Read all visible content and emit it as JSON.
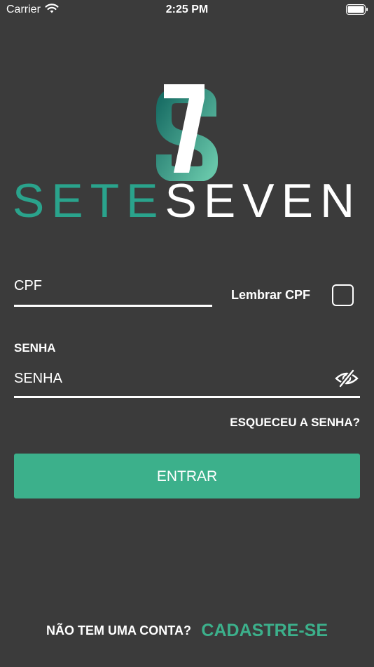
{
  "status_bar": {
    "carrier": "Carrier",
    "time": "2:25 PM",
    "wifi_icon": "wifi-icon",
    "battery_icon": "battery-icon"
  },
  "logo": {
    "brand_left": "SETE",
    "brand_right": "SEVEN",
    "mark_icon": "seven-s-logo-icon"
  },
  "form": {
    "cpf_placeholder": "CPF",
    "remember_label": "Lembrar CPF",
    "remember_checked": false,
    "password_label": "SENHA",
    "password_placeholder": "SENHA",
    "password_visibility_icon": "eye-slash-icon",
    "forgot_password": "ESQUECEU A SENHA?",
    "submit_label": "ENTRAR"
  },
  "footer": {
    "no_account": "NÃO TEM UMA CONTA?",
    "signup": "CADASTRE-SE"
  },
  "colors": {
    "background": "#3b3b3b",
    "accent": "#3cb08b",
    "brand_teal": "#2aa38c",
    "text": "#ffffff"
  }
}
